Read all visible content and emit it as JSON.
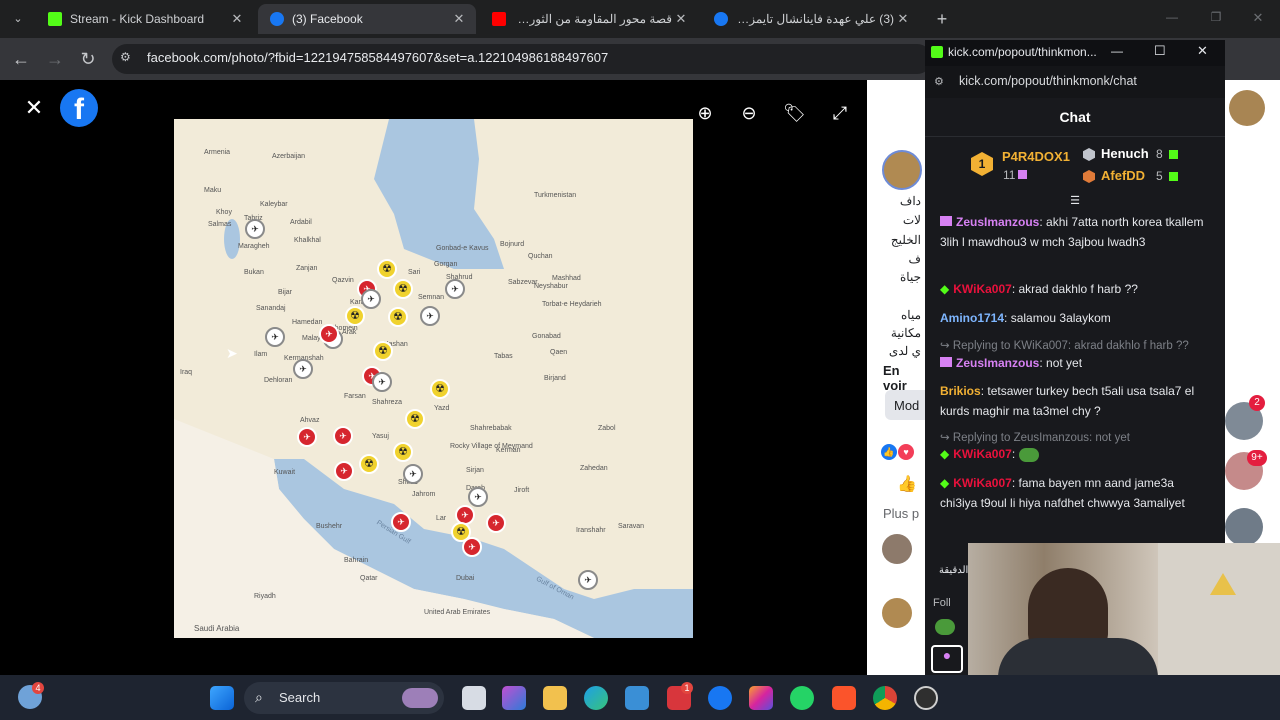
{
  "browser": {
    "tabs": [
      {
        "title": "Stream - Kick Dashboard",
        "icon": "kick-icon",
        "color": "#53fc18",
        "active": false
      },
      {
        "title": "(3) Facebook",
        "icon": "facebook-icon",
        "color": "#1877f2",
        "active": true
      },
      {
        "title": "قصة محور المقاومة من الثورة الإ",
        "icon": "youtube-icon",
        "color": "#ff0000",
        "active": false
      },
      {
        "title": "(3) علي عهدة فاينانشال تايمز داخ",
        "icon": "facebook-icon",
        "color": "#1877f2",
        "active": false
      }
    ],
    "url": "facebook.com/photo/?fbid=122194758584497607&set=a.122104986188497607"
  },
  "map": {
    "labels": {
      "armenia": "Armenia",
      "azerbaijan": "Azerbaijan",
      "turkmenistan": "Turkmenistan",
      "iraq": "Iraq",
      "kuwait": "Kuwait",
      "qatar": "Qatar",
      "uae": "United Arab Emirates",
      "saudi": "Saudi Arabia",
      "riyadh": "Riyadh",
      "dubai": "Dubai",
      "bahrain": "Bahrain",
      "persian_gulf": "Persian Gulf",
      "gulf_oman": "Gulf of Oman",
      "tabriz": "Tabriz",
      "ardabil": "Ardabil",
      "maragheh": "Maragheh",
      "urmia": "Urmia",
      "khoy": "Khoy",
      "salmas": "Salmas",
      "maku": "Maku",
      "kaleybar": "Kaleybar",
      "khalkhal": "Khalkhal",
      "zanjan": "Zanjan",
      "bukan": "Bukan",
      "bijar": "Bijar",
      "sanandaj": "Sanandaj",
      "hamedan": "Hamedan",
      "malayer": "Malayer",
      "kermanshah": "Kermanshah",
      "ilam": "Ilam",
      "qazvin": "Qazvin",
      "karaj": "Karaj",
      "sari": "Sari",
      "gorgan": "Gorgan",
      "gonbad": "Gonbad-e Kavus",
      "shahrud": "Shahrud",
      "semnan": "Semnan",
      "bojnurd": "Bojnurd",
      "quchan": "Quchan",
      "mashhad": "Mashhad",
      "sabzevar": "Sabzevar",
      "neyshabur": "Neyshabur",
      "torbat": "Torbat-e Heydarieh",
      "gonabad": "Gonabad",
      "tabas": "Tabas",
      "qaen": "Qaen",
      "birjand": "Birjand",
      "arak": "Arak",
      "qom": "Qom",
      "kashan": "Kashan",
      "khomein": "Khomein",
      "dehloran": "Dehloran",
      "farsan": "Farsan",
      "shahreza": "Shahreza",
      "yazd": "Yazd",
      "ardakan": "Ardakan",
      "ahvaz": "Ahvaz",
      "yasuj": "Yasuj",
      "abadeh": "Abadeh",
      "shiraz": "Shiraz",
      "shahrebabak": "Shahrebabak",
      "rocky": "Rocky Village of Meymand",
      "kerman": "Kerman",
      "sirjan": "Sirjan",
      "jahrom": "Jahrom",
      "darab": "Darab",
      "jiroft": "Jiroft",
      "zahedan": "Zahedan",
      "zabol": "Zabol",
      "iranshahr": "Iranshahr",
      "saravan": "Saravan",
      "lar": "Lar",
      "bandar": "Bandar Abbas",
      "bushehr": "Bushehr",
      "bam": "Bam",
      "ilam2": "Ilam"
    }
  },
  "viewer_controls": {
    "zoom_in": "zoom-in-icon",
    "zoom_out": "zoom-out-icon",
    "tag": "tag-icon",
    "fullscreen": "fullscreen-icon"
  },
  "fb_panel": {
    "lines": [
      "داف",
      "لات",
      "الخليج",
      "ف",
      "جياة",
      "مياه",
      "مكانية",
      "ي لدى"
    ],
    "en_voir": "En voir",
    "mod": "Mod",
    "plus": "Plus p",
    "comment_snip": "الدقيقة",
    "follow": "Foll",
    "badges": [
      "2",
      "9+"
    ]
  },
  "kick": {
    "window_title": "kick.com/popout/thinkmon...",
    "url": "kick.com/popout/thinkmonk/chat",
    "chat_title": "Chat",
    "leaderboard": {
      "first": {
        "rank": "1",
        "name": "P4R4DOX1",
        "count": "11"
      },
      "second": {
        "name": "Henuch",
        "count": "8"
      },
      "third": {
        "name": "AfefDD",
        "count": "5"
      }
    },
    "messages": [
      {
        "user": "ZeusImanzous",
        "user_color": "#d781f3",
        "text": "akhi 7atta north korea tkallem 3lih l mawdhou3 w mch 3ajbou lwadh3"
      },
      {
        "user": "KWiKa007",
        "user_color": "#e9113c",
        "text": "akrad dakhlo f harb ??"
      },
      {
        "user": "Amino1714",
        "user_color": "#7eb6ff",
        "text": "salamou 3alaykom"
      },
      {
        "user": "ZeusImanzous",
        "user_color": "#d781f3",
        "reply": "Replying to KWiKa007: akrad dakhlo f harb ??",
        "text": "not yet"
      },
      {
        "user": "Brikios",
        "user_color": "#f2b134",
        "text": "tetsawer turkey bech t5ali usa tsala7 el kurds maghir ma ta3mel chy ?"
      },
      {
        "user": "KWiKa007",
        "user_color": "#e9113c",
        "reply": "Replying to ZeusImanzous: not yet",
        "text": ""
      },
      {
        "user": "KWiKa007",
        "user_color": "#e9113c",
        "text": "fama bayen mn aand jame3a chi3iya t9oul li hiya nafdhet chwwya 3amaliyet"
      }
    ]
  },
  "taskbar": {
    "search_label": "Search",
    "weather_badge": "4",
    "notif_badge": "1"
  }
}
